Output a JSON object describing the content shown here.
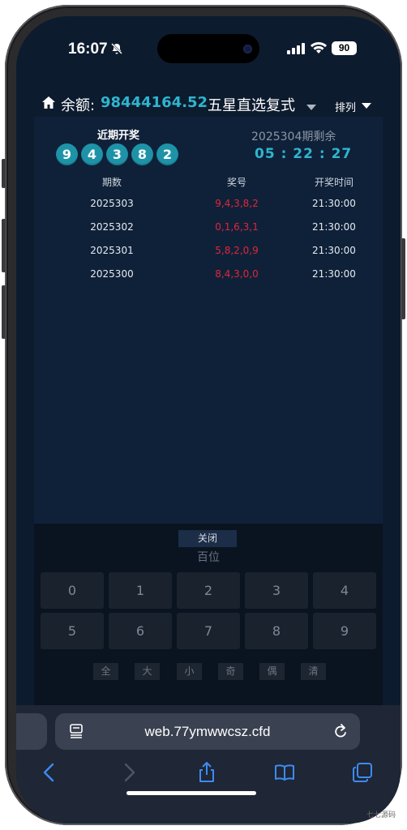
{
  "status_bar": {
    "time": "16:07",
    "battery": "90"
  },
  "header": {
    "balance_label": "余额:",
    "balance_value": "98444164.52",
    "play_type": "五星直选复式",
    "sort_label": "排列"
  },
  "draw": {
    "recent_title": "近期开奖",
    "balls": [
      "9",
      "4",
      "3",
      "8",
      "2"
    ],
    "period_remain": "2025304期剩余",
    "countdown": "05 : 22 : 27"
  },
  "table": {
    "headers": [
      "期数",
      "奖号",
      "开奖时间"
    ],
    "rows": [
      {
        "period": "2025303",
        "numbers": "9,4,3,8,2",
        "time": "21:30:00"
      },
      {
        "period": "2025302",
        "numbers": "0,1,6,3,1",
        "time": "21:30:00"
      },
      {
        "period": "2025301",
        "numbers": "5,8,2,0,9",
        "time": "21:30:00"
      },
      {
        "period": "2025300",
        "numbers": "8,4,3,0,0",
        "time": "21:30:00"
      }
    ]
  },
  "keypad": {
    "close_label": "关闭",
    "position_label": "百位",
    "digits": [
      "0",
      "1",
      "2",
      "3",
      "4",
      "5",
      "6",
      "7",
      "8",
      "9"
    ],
    "quick": [
      "全",
      "大",
      "小",
      "奇",
      "偶",
      "清"
    ]
  },
  "browser": {
    "url": "web.77ymwwcsz.cfd"
  },
  "watermark": "七七源码",
  "colors": {
    "accent": "#2fb5cf",
    "ball": "#1e93a8",
    "win_number": "#e0263a",
    "background": "#0d1b2e"
  }
}
